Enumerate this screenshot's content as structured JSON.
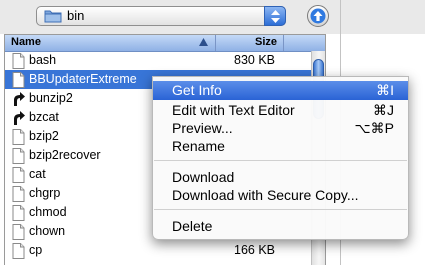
{
  "toolbar": {
    "path_label": "bin"
  },
  "list": {
    "header": {
      "name": "Name",
      "size": "Size"
    },
    "rows": [
      {
        "name": "bash",
        "size": "830 KB",
        "icon": "document-icon"
      },
      {
        "name": "BBUpdaterExtreme",
        "size": "",
        "icon": "document-icon",
        "selected": true
      },
      {
        "name": "bunzip2",
        "size": "",
        "icon": "alias-arrow-icon"
      },
      {
        "name": "bzcat",
        "size": "",
        "icon": "alias-arrow-icon"
      },
      {
        "name": "bzip2",
        "size": "",
        "icon": "document-icon"
      },
      {
        "name": "bzip2recover",
        "size": "",
        "icon": "document-icon"
      },
      {
        "name": "cat",
        "size": "",
        "icon": "document-icon"
      },
      {
        "name": "chgrp",
        "size": "",
        "icon": "document-icon"
      },
      {
        "name": "chmod",
        "size": "",
        "icon": "document-icon"
      },
      {
        "name": "chown",
        "size": "",
        "icon": "document-icon"
      },
      {
        "name": "cp",
        "size": "166 KB",
        "icon": "document-icon"
      }
    ]
  },
  "context_menu": {
    "items": [
      {
        "label": "Get Info",
        "shortcut": "⌘I",
        "highlighted": true
      },
      {
        "label": "Edit with Text Editor",
        "shortcut": "⌘J"
      },
      {
        "label": "Preview...",
        "shortcut": "⌥⌘P"
      },
      {
        "label": "Rename",
        "shortcut": ""
      },
      {
        "label": "Download",
        "shortcut": ""
      },
      {
        "label": "Download with Secure Copy...",
        "shortcut": ""
      },
      {
        "label": "Delete",
        "shortcut": ""
      }
    ]
  },
  "colors": {
    "selection": "#3875d7",
    "menu_highlight": "#2a63d5",
    "header": "#a9c6ef"
  }
}
